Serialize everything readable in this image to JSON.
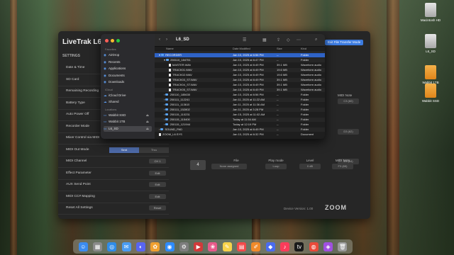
{
  "desktop": {
    "icons": [
      {
        "label": "Macintosh HD",
        "type": "drive"
      },
      {
        "label": "L6_SD",
        "type": "drive"
      },
      {
        "label": "Wabbit 1TB",
        "type": "drive-orange"
      },
      {
        "label": "Wabbit SSD",
        "type": "drive-orange"
      }
    ]
  },
  "app": {
    "title_main": "LiveTrak L6",
    "transfer_button": "Exit File Transfer Mode",
    "settings_heading": "SETTINGS",
    "settings_rows": [
      {
        "label": "Date & Time",
        "control": ""
      },
      {
        "label": "SD Card",
        "control": ""
      },
      {
        "label": "Remaining Recording",
        "control": ""
      },
      {
        "label": "Battery Type",
        "control": ""
      },
      {
        "label": "Auto Power Off",
        "control": ""
      },
      {
        "label": "Recorder Mode",
        "control": ""
      },
      {
        "label": "Mixer Control via MIDI",
        "control": ""
      },
      {
        "label": "MIDI Out Mode",
        "control": ""
      },
      {
        "label": "MIDI Channel",
        "control": "CH 1"
      },
      {
        "label": "Effect Parameter",
        "control": "Edit"
      },
      {
        "label": "AUX Send Point",
        "control": "Edit"
      },
      {
        "label": "MIDI CC# Mapping",
        "control": "Edit"
      },
      {
        "label": "Reset All Settings",
        "control": "Reset"
      }
    ],
    "midi_out_options": [
      "Sent",
      "Thru"
    ],
    "right_panel": {
      "midi_note_label": "MIDI Note",
      "notes_top": [
        "C3 (60)",
        "D3 (62)",
        "E3 (64)"
      ],
      "pad_number": "4",
      "labels": [
        "File",
        "Play mode",
        "Level",
        "MIDI Note"
      ],
      "values": [
        "None assigned",
        "Loop",
        "0 dB",
        "F3 (65)"
      ]
    },
    "version": "Device Version: 1.00",
    "brand": "ZOOM"
  },
  "finder": {
    "title": "L6_SD",
    "sidebar": {
      "favorites_label": "Favorites",
      "favorites": [
        "AirDrop",
        "Recents",
        "Applications",
        "Documents",
        "Downloads"
      ],
      "icloud_label": "iCloud",
      "icloud": [
        "iCloud Drive",
        "Shared"
      ],
      "locations_label": "Locations",
      "locations": [
        "Wabbit SSD",
        "Wabbit 1TB",
        "L6_SD"
      ]
    },
    "columns": {
      "name": "Name",
      "date": "Date Modified",
      "size": "Size",
      "kind": "Kind"
    },
    "rows": [
      {
        "name": "RECORDER",
        "date": "Jan 10, 2025 at 6:56 PM",
        "size": "--",
        "kind": "Folder",
        "type": "folder",
        "indent": 0,
        "selected": true
      },
      {
        "name": "250110_184751",
        "date": "Jan 10, 2025 at 6:47 PM",
        "size": "--",
        "kind": "Folder",
        "type": "folder",
        "indent": 1
      },
      {
        "name": "MASTER.WAV",
        "date": "Jan 10, 2025 at 6:49 PM",
        "size": "39.1 MB",
        "kind": "Waveform audio",
        "type": "file",
        "indent": 2
      },
      {
        "name": "TRACK01.WAV",
        "date": "Jan 10, 2025 at 6:49 PM",
        "size": "19.6 MB",
        "kind": "Waveform audio",
        "type": "file",
        "indent": 2
      },
      {
        "name": "TRACK02.WAV",
        "date": "Jan 10, 2025 at 6:49 PM",
        "size": "19.6 MB",
        "kind": "Waveform audio",
        "type": "file",
        "indent": 2
      },
      {
        "name": "TRACK03_ST.WAV",
        "date": "Jan 10, 2025 at 6:49 PM",
        "size": "39.1 MB",
        "kind": "Waveform audio",
        "type": "file",
        "indent": 2
      },
      {
        "name": "TRACK04_ST.WAV",
        "date": "Jan 10, 2025 at 6:49 PM",
        "size": "39.1 MB",
        "kind": "Waveform audio",
        "type": "file",
        "indent": 2
      },
      {
        "name": "TRACK05_ST.WAV",
        "date": "Jan 10, 2025 at 6:49 PM",
        "size": "39.1 MB",
        "kind": "Waveform audio",
        "type": "file",
        "indent": 2
      },
      {
        "name": "250110_185630",
        "date": "Jan 10, 2025 at 6:56 PM",
        "size": "--",
        "kind": "Folder",
        "type": "folder",
        "indent": 1
      },
      {
        "name": "250111_112241",
        "date": "Jan 11, 2025 at 11:22 AM",
        "size": "--",
        "kind": "Folder",
        "type": "folder",
        "indent": 1
      },
      {
        "name": "250111_113615",
        "date": "Jan 11, 2025 at 11:36 AM",
        "size": "--",
        "kind": "Folder",
        "type": "folder",
        "indent": 1
      },
      {
        "name": "250111_152802",
        "date": "Jan 11, 2025 at 3:28 PM",
        "size": "--",
        "kind": "Folder",
        "type": "folder",
        "indent": 1
      },
      {
        "name": "250115_110231",
        "date": "Jan 15, 2025 at 11:02 AM",
        "size": "--",
        "kind": "Folder",
        "type": "folder",
        "indent": 1
      },
      {
        "name": "250115_115400",
        "date": "Today at 11:54 AM",
        "size": "--",
        "kind": "Folder",
        "type": "folder",
        "indent": 1
      },
      {
        "name": "250115_121944",
        "date": "Today at 12:19 PM",
        "size": "--",
        "kind": "Folder",
        "type": "folder",
        "indent": 1
      },
      {
        "name": "SOUND_PAD",
        "date": "Jan 10, 2025 at 6:49 PM",
        "size": "--",
        "kind": "Folder",
        "type": "folder",
        "indent": 0
      },
      {
        "name": "ZOOM_L6.SYS",
        "date": "Jan 10, 2025 at 6:32 PM",
        "size": "--",
        "kind": "Document",
        "type": "file",
        "indent": 0
      }
    ]
  },
  "dock": {
    "icons": [
      "finder-icon",
      "launchpad-icon",
      "safari-icon",
      "mail-icon",
      "discord-icon",
      "photos-icon",
      "zoom-icon",
      "settings-icon",
      "media-icon",
      "photo-icon",
      "notes-icon",
      "calendar-icon",
      "pages-icon",
      "app-icon",
      "music-icon",
      "tv-icon",
      "chrome-icon",
      "podcasts-icon",
      "trash-icon"
    ]
  }
}
